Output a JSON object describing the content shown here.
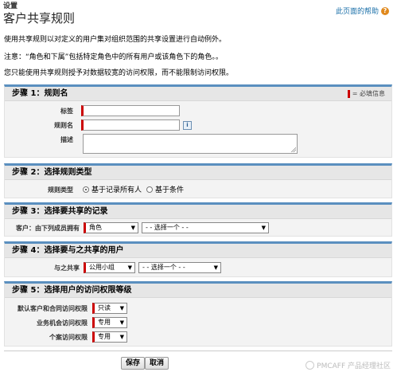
{
  "header": {
    "breadcrumb": "设置",
    "title": "客户共享规则",
    "help_link": "此页面的帮助"
  },
  "descriptions": [
    "使用共享规则以对定义的用户集对组织范围的共享设置进行自动例外。",
    "注意：“角色和下属”包括特定角色中的所有用户或该角色下的角色。。",
    "您只能使用共享规则授予对数据较宽的访问权限，而不能限制访问权限。"
  ],
  "required_legend": "= 必填信息",
  "step1": {
    "title": "步骤 1：规则名",
    "label_field": "标签",
    "rule_name_field": "规则名",
    "description_field": "描述",
    "info_icon": "i"
  },
  "step2": {
    "title": "步骤 2：选择规则类型",
    "rule_type_label": "规则类型",
    "option_owner": "基于记录所有人",
    "option_criteria": "基于条件",
    "selected": "基于记录所有人"
  },
  "step3": {
    "title": "步骤 3：选择要共享的记录",
    "owner_label": "客户：由下列成员拥有",
    "type_select": "角色",
    "value_select": "- - 选择一个 - -"
  },
  "step4": {
    "title": "步骤 4：选择要与之共享的用户",
    "share_with_label": "与之共享",
    "type_select": "公用小组",
    "value_select": "- - 选择一个 - -"
  },
  "step5": {
    "title": "步骤 5：选择用户的访问权限等级",
    "rows": [
      {
        "label": "默认客户和合同访问权限",
        "value": "只读"
      },
      {
        "label": "业务机会访问权限",
        "value": "专用"
      },
      {
        "label": "个案访问权限",
        "value": "专用"
      }
    ]
  },
  "buttons": {
    "save": "保存",
    "cancel": "取消"
  },
  "watermark": "PMCAFF 产品经理社区",
  "colors": {
    "accent": "#5a8fbf",
    "required": "#cc0000",
    "link": "#1a6fa8"
  }
}
